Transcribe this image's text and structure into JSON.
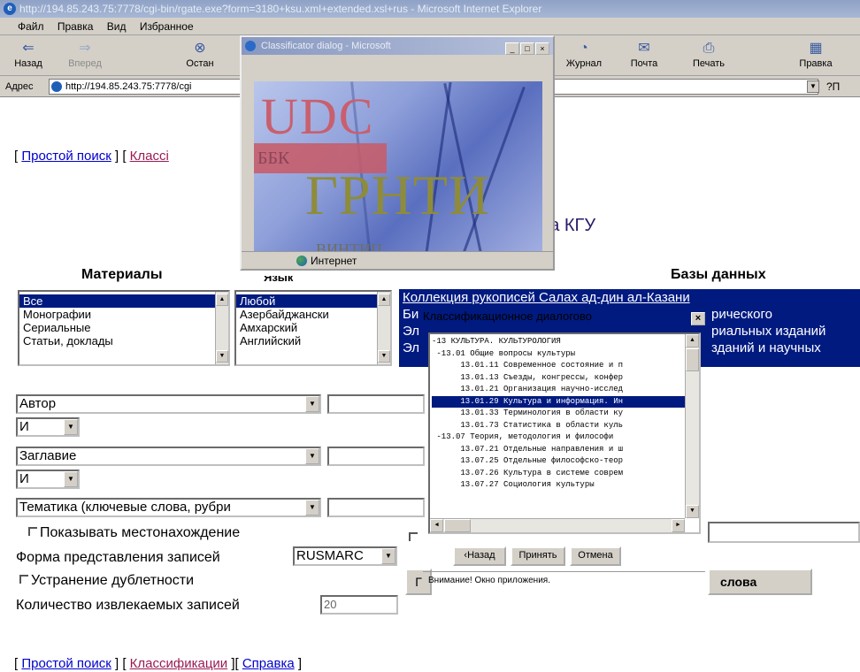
{
  "browser": {
    "title": "http://194.85.243.75:7778/cgi-bin/rgate.exe?form=3180+ksu.xml+extended.xsl+rus - Microsoft Internet Explorer",
    "menu": [
      "Файл",
      "Правка",
      "Вид",
      "Избранное"
    ],
    "toolbar": {
      "back": "Назад",
      "forward": "Вперед",
      "stop": "Остан",
      "history": "Журнал",
      "mail": "Почта",
      "print": "Печать",
      "edit": "Правка"
    },
    "address_label": "Адрес",
    "address_value": "http://194.85.243.75:7778/cgi",
    "go_label": "?П"
  },
  "nav_top": {
    "simple_search": "Простой поиск",
    "classif": "Классі"
  },
  "page_title": "ка КГУ",
  "columns": {
    "materials": "Материалы",
    "language": "Язык",
    "databases": "Базы данных"
  },
  "materials": [
    "Все",
    "Монографии",
    "Сериальные",
    "Статьи, доклады"
  ],
  "languages": [
    "Любой",
    "Азербайджански",
    "Амхарский",
    "Английский"
  ],
  "databases": [
    "Коллекция рукописей Салах ад-дин ал-Казани",
    "Би",
    "рического",
    "Эл",
    "риальных изданий",
    "Эл",
    "зданий и научных"
  ],
  "search": {
    "field1": "Автор",
    "op1": "И",
    "field2": "Заглавие",
    "op2": "И",
    "field3": "Тематика (ключевые слова, рубри"
  },
  "options": {
    "show_location": "Показывать местонахождение",
    "format_label": "Форма представления записей",
    "format_value": "RUSMARC",
    "dedup": "Устранение дублетности",
    "count_label": "Количество извлекаемых записей",
    "count_value": "20"
  },
  "button_partial": "Г",
  "button_words": "слова",
  "nav_bottom": {
    "simple_search": "Простой поиск",
    "classif": "Классификации",
    "help": "Справка"
  },
  "popup1": {
    "title": "Classificator dialog - Microsoft",
    "text_udc": "UDC",
    "text_bbk": "ББК",
    "text_grnti": "ГРНТИ",
    "text_vintic": "ВИНТИЦ",
    "status": "Интернет"
  },
  "popup2": {
    "title": "Классификационное диалогово",
    "rows": [
      "-13 КУЛЬТУРА. КУЛЬТУРОЛОГИЯ",
      " -13.01 Общие вопросы культуры",
      "      13.01.11 Современное состояние и п",
      "      13.01.13 Съезды, конгрессы, конфер",
      "      13.01.21 Организация научно-исслед",
      "      13.01.29 Культура и информация. Ин",
      "      13.01.33 Терминология в области ку",
      "      13.01.73 Статистика в области куль",
      " -13.07 Теория, методология и философи",
      "      13.07.21 Отдельные направления и ш",
      "      13.07.25 Отдельные философско-теор",
      "      13.07.26 Культура в системе соврем",
      "      13.07.27 Социология культуры"
    ],
    "selected_index": 5,
    "back": "‹Назад",
    "accept": "Принять",
    "cancel": "Отмена",
    "status": "Внимание! Окно приложения."
  },
  "colors": {
    "link": "#0000cc",
    "visited": "#9a1a55",
    "selection": "#001a80",
    "title": "#2a1a6a"
  }
}
